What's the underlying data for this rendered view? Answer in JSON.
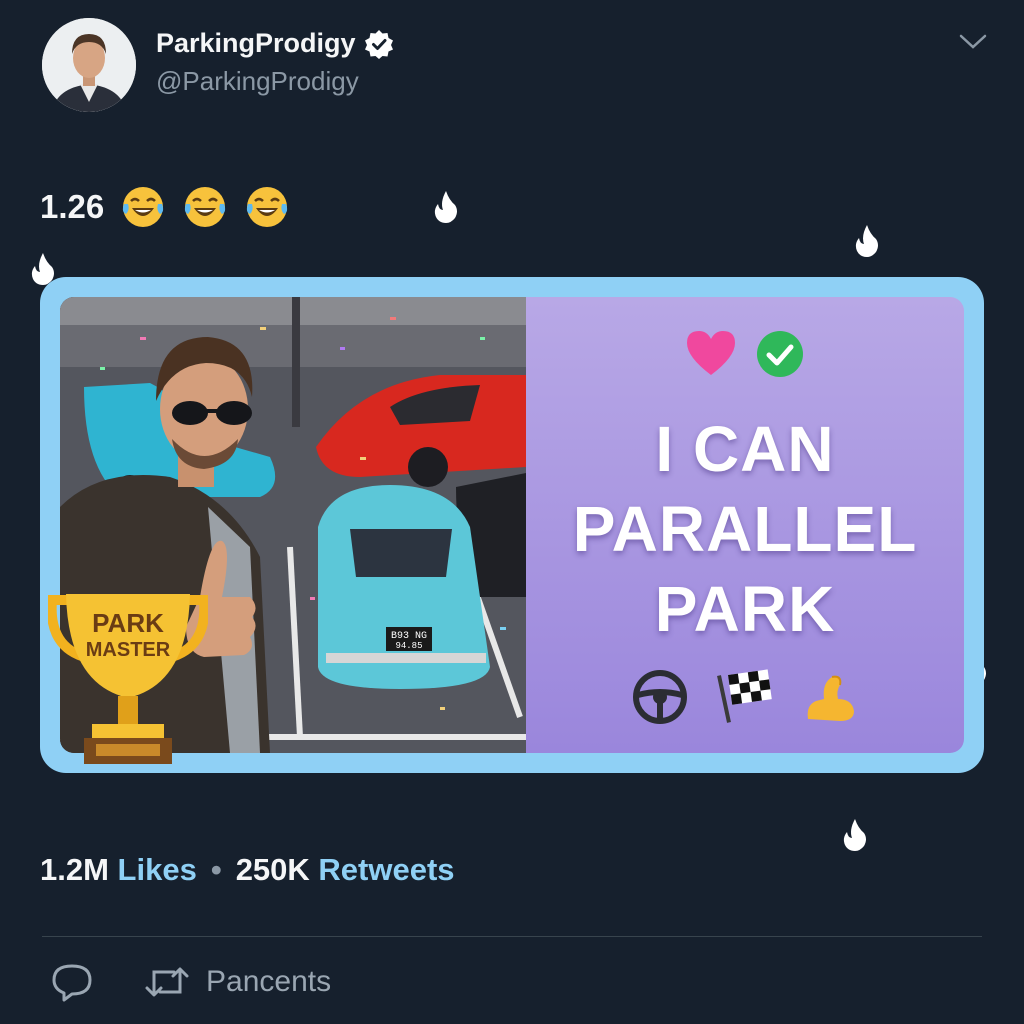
{
  "user": {
    "display_name": "ParkingProdigy",
    "handle": "@ParkingProdigy"
  },
  "tweet": {
    "text": "1.26",
    "emojis": [
      "laughing-crying-emoji",
      "laughing-crying-emoji",
      "laughing-crying-emoji"
    ]
  },
  "card": {
    "headline": [
      "I CAN",
      "PARALLEL",
      "PARK"
    ],
    "top_emojis": [
      "pink-heart-emoji",
      "green-check-emoji"
    ],
    "bottom_emojis": [
      "steering-wheel-emoji",
      "checkered-flag-emoji",
      "flexed-biceps-emoji"
    ],
    "trophy_text": [
      "PARK",
      "MASTER"
    ],
    "plate_text": [
      "B93 NG",
      "94.85"
    ]
  },
  "stats": {
    "likes_count": "1.2M",
    "likes_label": "Likes",
    "separator": "•",
    "retweets_count": "250K",
    "retweets_label": "Retweets"
  },
  "actions": {
    "retweet_label": "Pancents"
  },
  "colors": {
    "background": "#16202d",
    "accent": "#8fd0f5",
    "panel": "#a897e0",
    "verified": "#ffffff"
  }
}
